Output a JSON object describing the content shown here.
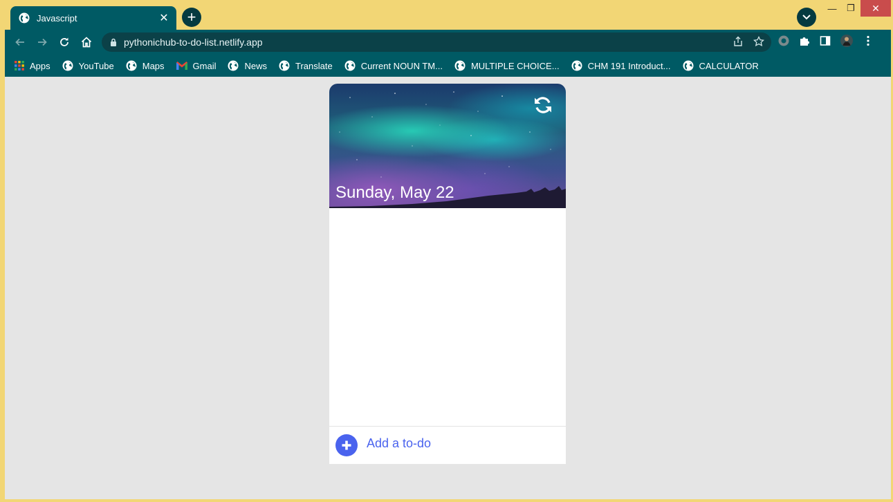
{
  "browser": {
    "tab_title": "Javascript",
    "tab_close": "✕",
    "new_tab": "+",
    "url": "pythonichub-to-do-list.netlify.app",
    "window_controls": {
      "minimize": "—",
      "maximize": "❐",
      "close": "✕"
    },
    "accent_color": "#005a64"
  },
  "bookmarks": [
    {
      "label": "Apps",
      "icon": "apps-grid-icon"
    },
    {
      "label": "YouTube",
      "icon": "globe-icon"
    },
    {
      "label": "Maps",
      "icon": "globe-icon"
    },
    {
      "label": "Gmail",
      "icon": "gmail-icon"
    },
    {
      "label": "News",
      "icon": "globe-icon"
    },
    {
      "label": "Translate",
      "icon": "globe-icon"
    },
    {
      "label": "Current NOUN TM...",
      "icon": "globe-icon"
    },
    {
      "label": "MULTIPLE CHOICE...",
      "icon": "globe-icon"
    },
    {
      "label": "CHM 191 Introduct...",
      "icon": "globe-icon"
    },
    {
      "label": "CALCULATOR",
      "icon": "globe-icon"
    }
  ],
  "app": {
    "date": "Sunday, May 22",
    "add_todo": "Add a to-do",
    "accent_color": "#4a63ee",
    "todos": []
  }
}
